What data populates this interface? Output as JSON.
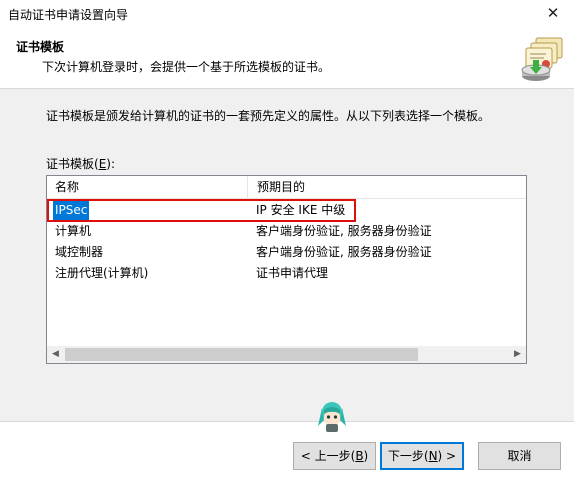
{
  "window": {
    "title": "自动证书申请设置向导",
    "close_glyph": "✕"
  },
  "header": {
    "title": "证书模板",
    "subtitle": "下次计算机登录时，会提供一个基于所选模板的证书。"
  },
  "body": {
    "description": "证书模板是颁发给计算机的证书的一套预先定义的属性。从以下列表选择一个模板。",
    "list_label_prefix": "证书模板(",
    "list_label_key": "E",
    "list_label_suffix": "):",
    "columns": [
      "名称",
      "预期目的"
    ],
    "rows": [
      {
        "name": "IPSec",
        "purpose": "IP 安全 IKE 中级",
        "selected": true
      },
      {
        "name": "计算机",
        "purpose": "客户端身份验证, 服务器身份验证"
      },
      {
        "name": "域控制器",
        "purpose": "客户端身份验证, 服务器身份验证"
      },
      {
        "name": "注册代理(计算机)",
        "purpose": "证书申请代理"
      }
    ],
    "scroll_left": "◀",
    "scroll_right": "▶"
  },
  "buttons": {
    "back_prefix": "< 上一步(",
    "back_key": "B",
    "back_suffix": ")",
    "next_prefix": "下一步(",
    "next_key": "N",
    "next_suffix": ") >",
    "cancel": "取消"
  },
  "colors": {
    "selection": "#0078d7",
    "highlight_box": "#e00d0d",
    "body_bg": "#f0f0f0"
  }
}
